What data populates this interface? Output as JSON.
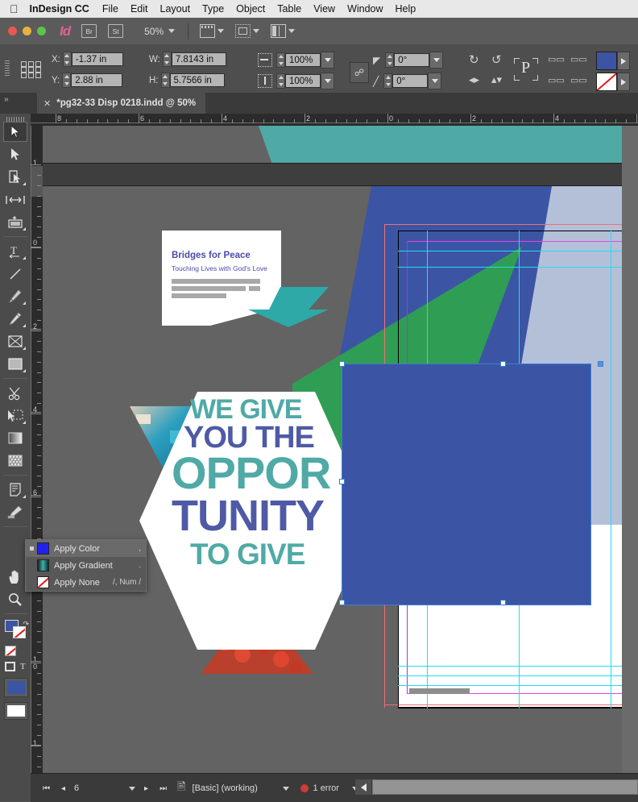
{
  "menubar": {
    "apple_icon": "apple-logo",
    "app_name": "InDesign CC",
    "items": [
      "File",
      "Edit",
      "Layout",
      "Type",
      "Object",
      "Table",
      "View",
      "Window",
      "Help"
    ]
  },
  "apptoolbar": {
    "logo": "Id",
    "bridge_label": "Br",
    "stock_label": "St",
    "zoom_level": "50%",
    "view_buttons": [
      "screen-mode-icon",
      "preview-mode-icon",
      "arrange-documents-icon"
    ]
  },
  "control_panel": {
    "reference_point_icon": "reference-point-grid",
    "x_label": "X:",
    "x_value": "-1.37 in",
    "y_label": "Y:",
    "y_value": "2.88 in",
    "w_label": "W:",
    "w_value": "7.8143 in",
    "h_label": "H:",
    "h_value": "5.7566 in",
    "scale_x_value": "100%",
    "scale_y_value": "100%",
    "rotation_value": "0°",
    "shear_value": "0°",
    "constrain_icon": "chain-link-icon",
    "effects_icon": "effects-icon",
    "rotate_cw_icon": "rotate-clockwise-icon",
    "rotate_ccw_icon": "rotate-counterclockwise-icon",
    "flip_h_icon": "flip-horizontal-icon",
    "flip_v_icon": "flip-vertical-icon",
    "container_label": "P",
    "fill_color": "#3b55a4",
    "stroke_color": "none",
    "align_icons": [
      "bring-to-front-icon",
      "bring-forward-icon",
      "send-to-back-icon",
      "send-backward-icon"
    ]
  },
  "tab": {
    "close_icon": "close-icon",
    "title": "*pg32-33 Disp 0218.indd @ 50%",
    "panel_expand_icon": "chevron-double-right-icon"
  },
  "tools": [
    {
      "name": "selection-tool",
      "selected": true
    },
    {
      "name": "direct-selection-tool",
      "selected": false
    },
    {
      "name": "page-tool",
      "selected": false
    },
    {
      "name": "gap-tool",
      "selected": false
    },
    {
      "name": "content-collector-tool",
      "selected": false
    },
    {
      "name": "type-tool",
      "selected": false
    },
    {
      "name": "line-tool",
      "selected": false
    },
    {
      "name": "pen-tool",
      "selected": false
    },
    {
      "name": "pencil-tool",
      "selected": false
    },
    {
      "name": "rectangle-frame-tool",
      "selected": false
    },
    {
      "name": "rectangle-tool",
      "selected": false
    },
    {
      "name": "scissors-tool",
      "selected": false
    },
    {
      "name": "free-transform-tool",
      "selected": false
    },
    {
      "name": "gradient-swatch-tool",
      "selected": false
    },
    {
      "name": "gradient-feather-tool",
      "selected": false
    },
    {
      "name": "note-tool",
      "selected": false
    },
    {
      "name": "eyedropper-tool",
      "selected": false
    },
    {
      "name": "hand-tool",
      "selected": false
    },
    {
      "name": "zoom-tool",
      "selected": false
    }
  ],
  "rulers": {
    "horizontal_labels": [
      "8",
      "6",
      "4",
      "2",
      "0",
      "2",
      "4"
    ],
    "vertical_labels": [
      "1",
      "0",
      "2",
      "4",
      "6",
      "1 0",
      "1"
    ],
    "units": "in"
  },
  "context_menu": {
    "items": [
      {
        "label": "Apply Color",
        "shortcut": ",",
        "swatch": "#2222ee",
        "icon": "color-swatch-icon",
        "highlighted": true
      },
      {
        "label": "Apply Gradient",
        "shortcut": ".",
        "swatch": "gradient",
        "icon": "gradient-swatch-icon",
        "highlighted": false
      },
      {
        "label": "Apply None",
        "shortcut": "/, Num /",
        "swatch": "none",
        "icon": "none-swatch-icon",
        "highlighted": false
      }
    ]
  },
  "artwork": {
    "card_title": "Bridges for Peace",
    "card_subtitle": "Touching Lives with God's Love",
    "headline_lines": [
      {
        "text": "WE GIVE",
        "color_role": "teal"
      },
      {
        "text": "YOU THE",
        "color_role": "purple"
      },
      {
        "text": "OPPOR",
        "color_role": "teal"
      },
      {
        "text": "TUNITY",
        "color_role": "purple"
      },
      {
        "text": "TO GIVE",
        "color_role": "teal"
      }
    ],
    "colors": {
      "teal": "#4faaa6",
      "purple": "#4f5aa6",
      "blue": "#3b55a4",
      "green": "#2f9e54",
      "light_blue": "#b4c0d8"
    }
  },
  "statusbar": {
    "first_page_icon": "first-page-icon",
    "prev_page_icon": "previous-page-icon",
    "page_number": "6",
    "next_page_icon": "next-page-icon",
    "last_page_icon": "last-page-icon",
    "preflight_icon": "preflight-document-icon",
    "preflight_profile": "[Basic] (working)",
    "error_count": "1 error",
    "error_color": "#d03a38",
    "scroll_left_icon": "scroll-left-arrow"
  }
}
